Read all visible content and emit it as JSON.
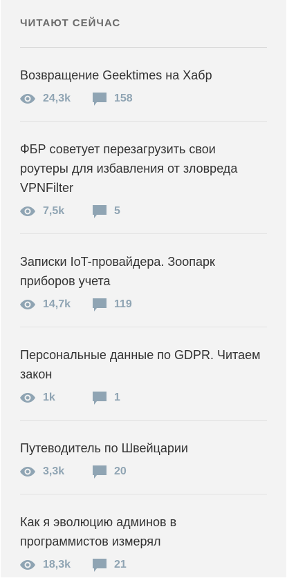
{
  "widget": {
    "title": "ЧИТАЮТ СЕЙЧАС"
  },
  "colors": {
    "background": "#f3f3f3",
    "title_text": "#333333",
    "meta_text": "#8fa4b3",
    "heading": "#6b6b6b"
  },
  "icons": {
    "views": "eye-icon",
    "comments": "comment-icon"
  },
  "posts": [
    {
      "title": "Возвращение Geektimes на Хабр",
      "views": "24,3k",
      "comments": "158"
    },
    {
      "title": "ФБР советует перезагрузить свои роутеры для избавления от зловреда VPNFilter",
      "views": "7,5k",
      "comments": "5"
    },
    {
      "title": "Записки IoT-провайдера. Зоопарк приборов учета",
      "views": "14,7k",
      "comments": "119"
    },
    {
      "title": "Персональные данные по GDPR. Читаем закон",
      "views": "1k",
      "comments": "1"
    },
    {
      "title": "Путеводитель по Швейцарии",
      "views": "3,3k",
      "comments": "20"
    },
    {
      "title": "Как я эволюцию админов в программистов измерял",
      "views": "18,3k",
      "comments": "21"
    }
  ]
}
